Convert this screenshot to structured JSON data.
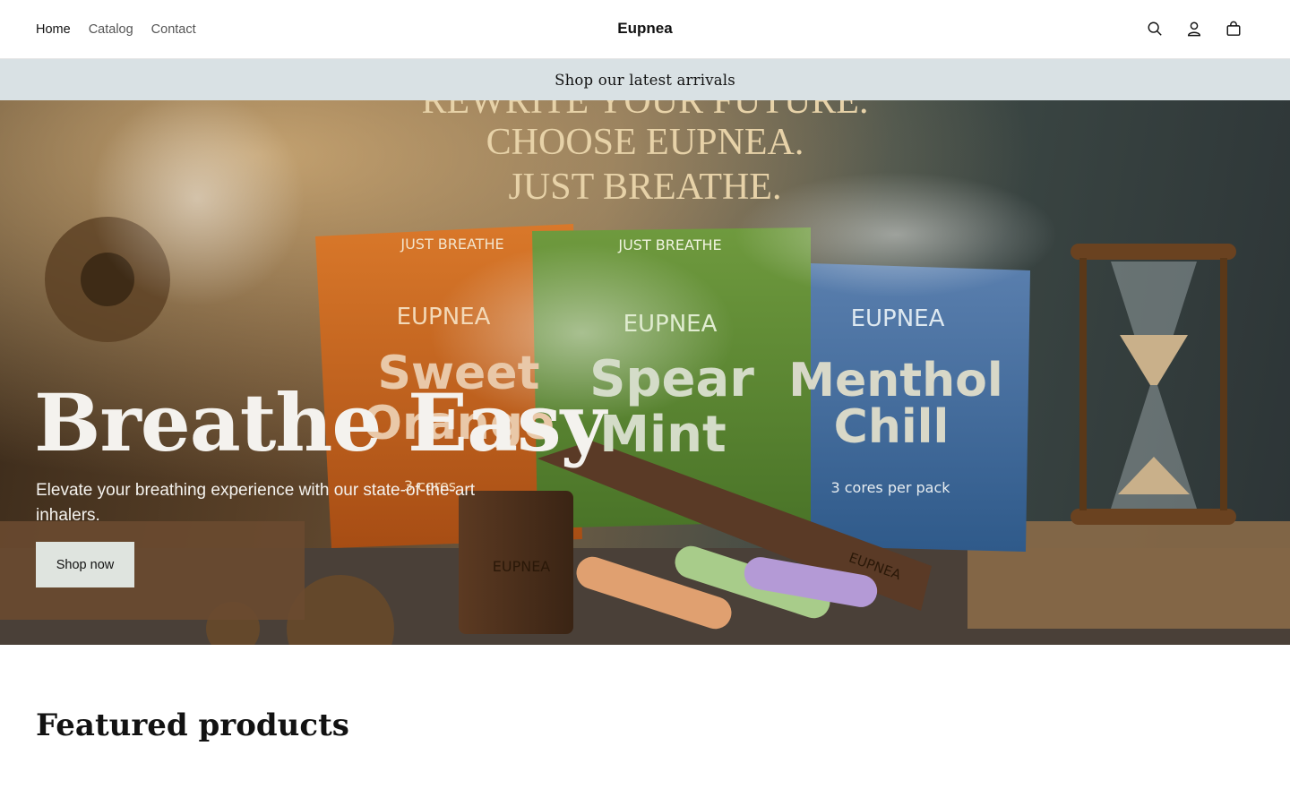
{
  "header": {
    "nav": [
      {
        "label": "Home",
        "active": true
      },
      {
        "label": "Catalog",
        "active": false
      },
      {
        "label": "Contact",
        "active": false
      }
    ],
    "logo": "Eupnea",
    "icons": [
      "search-icon",
      "account-icon",
      "cart-icon"
    ]
  },
  "announcement": {
    "text": "Shop our latest arrivals"
  },
  "hero": {
    "image_text": {
      "tagline_lines": [
        "REWRITE YOUR FUTURE.",
        "CHOOSE EUPNEA.",
        "JUST BREATHE."
      ],
      "packs": [
        {
          "top": "JUST BREATHE",
          "brand": "EUPNEA",
          "name_lines": [
            "Sweet",
            "Orange"
          ],
          "note": "3 cores"
        },
        {
          "top": "JUST BREATHE",
          "brand": "EUPNEA",
          "name_lines": [
            "Spear",
            "Mint"
          ],
          "note": ""
        },
        {
          "top": "",
          "brand": "EUPNEA",
          "name_lines": [
            "Menthol",
            "Chill"
          ],
          "note": "3 cores per pack"
        }
      ],
      "device_brand": "EUPNEA",
      "jar_brand": "EUPNEA"
    },
    "title": "Breathe Easy",
    "subtitle": "Elevate your breathing experience with our state-of-the-art inhalers.",
    "button_label": "Shop now"
  },
  "featured": {
    "title": "Featured products"
  },
  "colors": {
    "announcement_bg": "#d9e1e4",
    "button_bg": "#dfe4df",
    "pack_orange": "#c8641e",
    "pack_green": "#5d8a36",
    "pack_blue": "#3e6a9a"
  }
}
